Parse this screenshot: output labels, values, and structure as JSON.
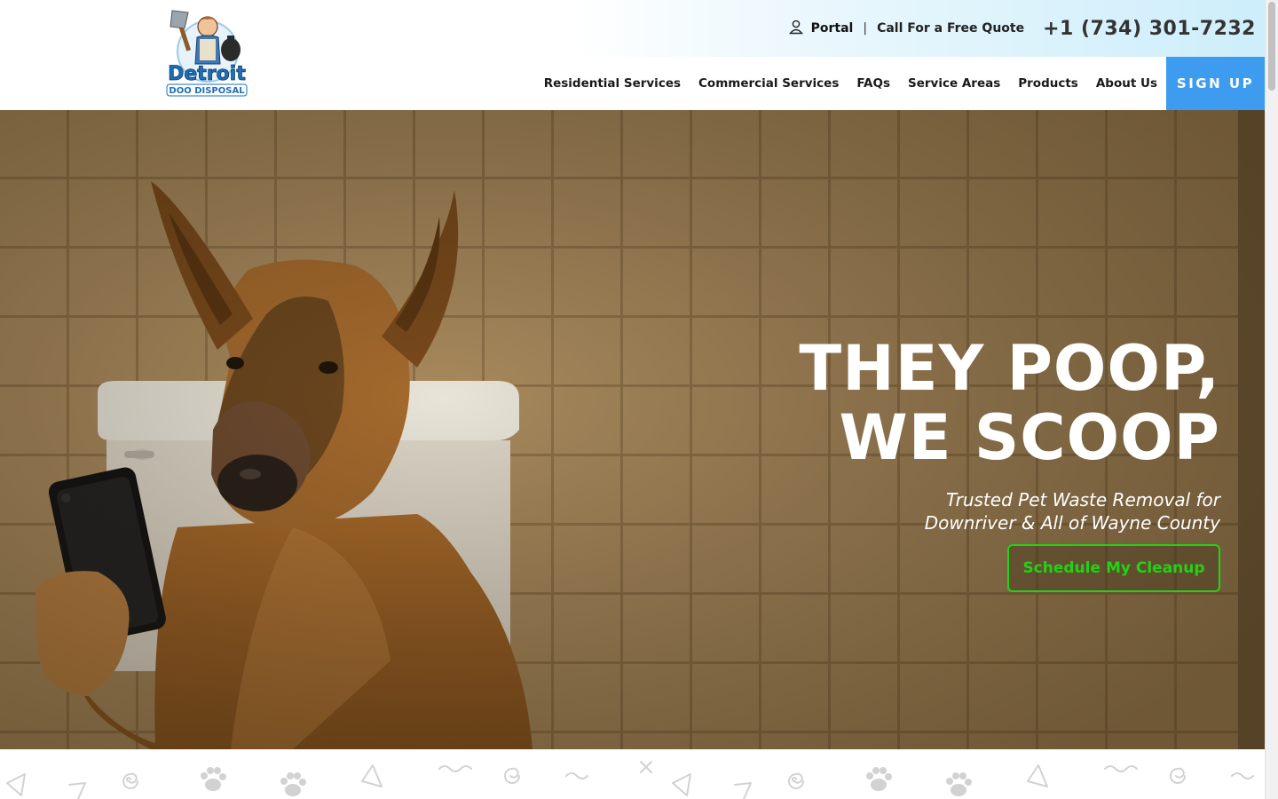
{
  "brand": {
    "logo_line1": "Detroit",
    "logo_line2": "DOO DISPOSAL"
  },
  "topbar": {
    "portal_label": "Portal",
    "separator": "|",
    "quote_label": "Call For a Free Quote",
    "phone": "+1 (734) 301-7232"
  },
  "nav": {
    "items": [
      {
        "label": "Residential Services"
      },
      {
        "label": "Commercial Services"
      },
      {
        "label": "FAQs"
      },
      {
        "label": "Service Areas"
      },
      {
        "label": "Products"
      },
      {
        "label": "About Us"
      }
    ],
    "signup_label": "SIGN UP"
  },
  "hero": {
    "title_line1": "THEY POOP,",
    "title_line2": "WE SCOOP",
    "subtitle_line1": "Trusted Pet Waste Removal for",
    "subtitle_line2": "Downriver & All of Wayne County",
    "cta_label": "Schedule My Cleanup"
  },
  "colors": {
    "accent_blue": "#3d9cf0",
    "cta_green": "#22d313",
    "logo_blue": "#1e6fb8"
  },
  "icons": {
    "portal": "user-icon",
    "pattern": [
      "triangle-icon",
      "spiral-icon",
      "paw-icon",
      "squiggle-icon",
      "cross-icon"
    ]
  }
}
